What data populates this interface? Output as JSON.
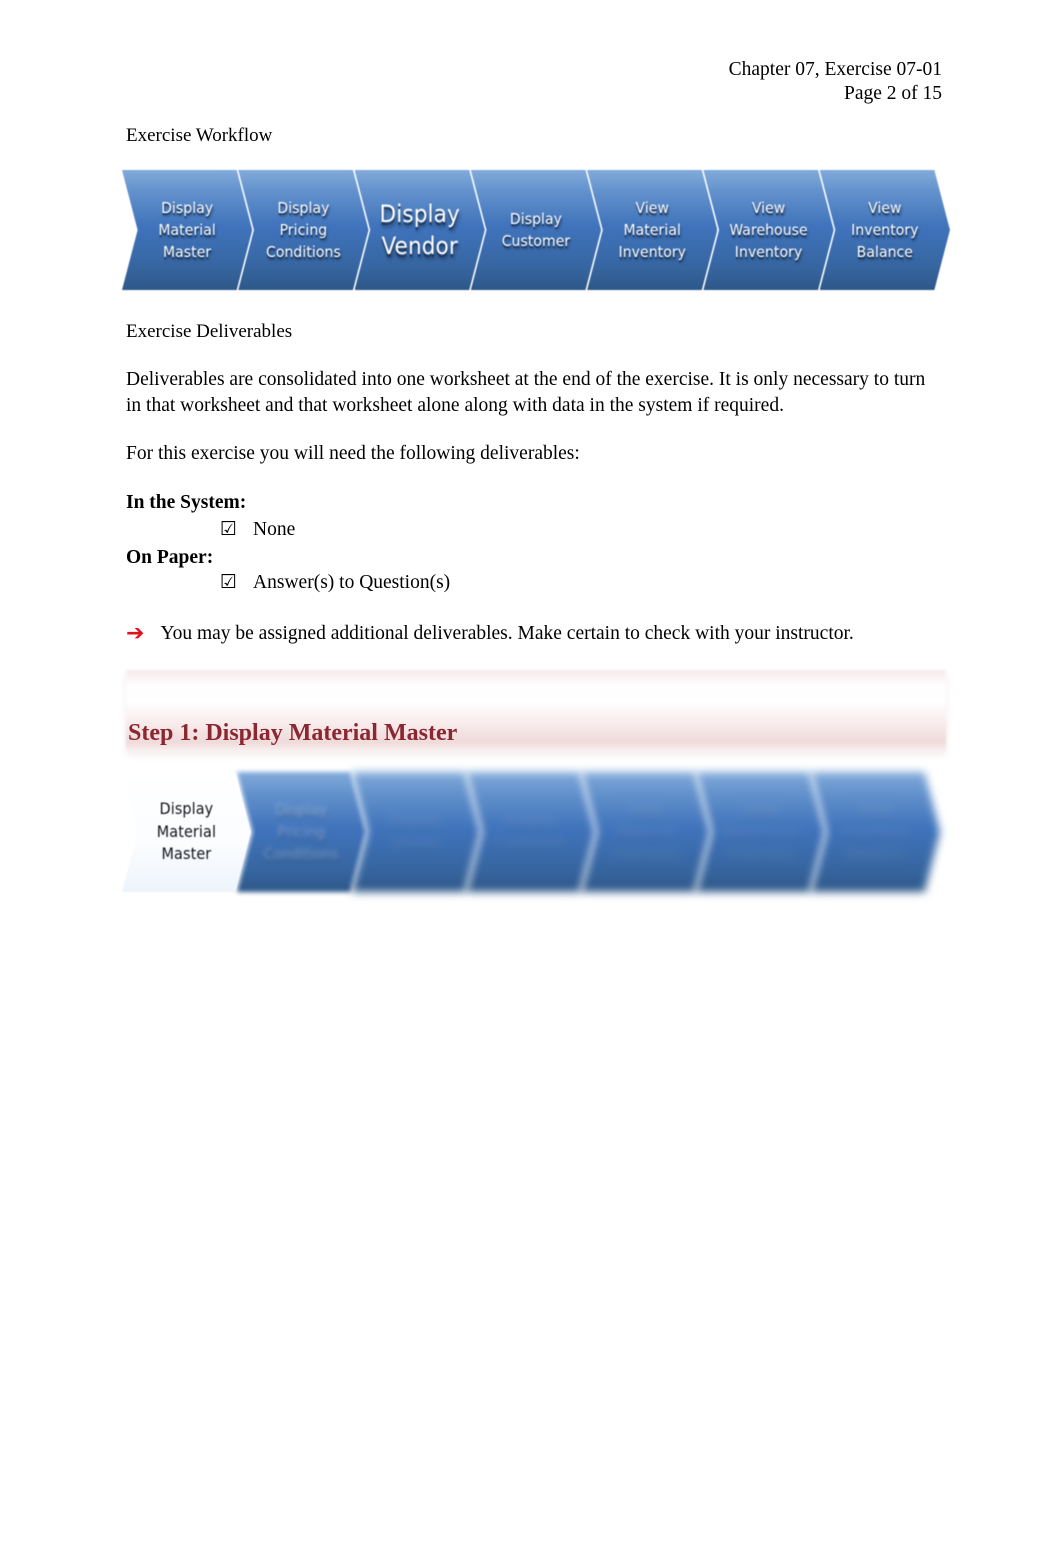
{
  "header": {
    "line1": "Chapter 07, Exercise 07-01",
    "line2": "Page 2 of 15"
  },
  "sections": {
    "workflow_label": "Exercise Workflow",
    "deliverables_label": "Exercise Deliverables"
  },
  "workflow": {
    "steps": [
      {
        "label": "Display\nMaterial\nMaster",
        "emphasis": false
      },
      {
        "label": "Display\nPricing\nConditions",
        "emphasis": false
      },
      {
        "label": "Display\nVendor",
        "emphasis": true
      },
      {
        "label": "Display\nCustomer",
        "emphasis": false
      },
      {
        "label": "View\nMaterial\nInventory",
        "emphasis": false
      },
      {
        "label": "View\nWarehouse\nInventory",
        "emphasis": false
      },
      {
        "label": "View\nInventory\nBalance",
        "emphasis": false
      }
    ]
  },
  "step_workflow": {
    "steps": [
      {
        "label": "Display\nMaterial\nMaster",
        "state": "active"
      },
      {
        "label": "Display\nPricing\nConditions",
        "state": "dim"
      },
      {
        "label": "Display\nVendor",
        "state": "dim2"
      },
      {
        "label": "Display\nCustomer",
        "state": "dim2"
      },
      {
        "label": "View\nMaterial\nInventory",
        "state": "dim2"
      },
      {
        "label": "View\nWarehouse\nInventory",
        "state": "dim2"
      },
      {
        "label": "View\nInventory\nBalance",
        "state": "dim2"
      }
    ]
  },
  "body": {
    "paragraph_1": "Deliverables are consolidated into one worksheet at the end of the exercise. It is only necessary to turn in that worksheet and that worksheet alone along with data in the system if required.",
    "paragraph_2": "For this exercise you will need the following deliverables:",
    "in_system_label": "In the System:",
    "in_system_item": "None",
    "on_paper_label": "On Paper:",
    "on_paper_item": "Answer(s) to Question(s)",
    "checkbox_glyph": "☑",
    "arrow_glyph": "➔",
    "note": "You may be assigned additional deliverables. Make certain to check with your instructor."
  },
  "step": {
    "title": "Step 1: Display Material Master"
  },
  "colors": {
    "chevron_blue": "#3f72ba",
    "step_title_maroon": "#8a2730",
    "arrow_red": "#e2111f"
  }
}
